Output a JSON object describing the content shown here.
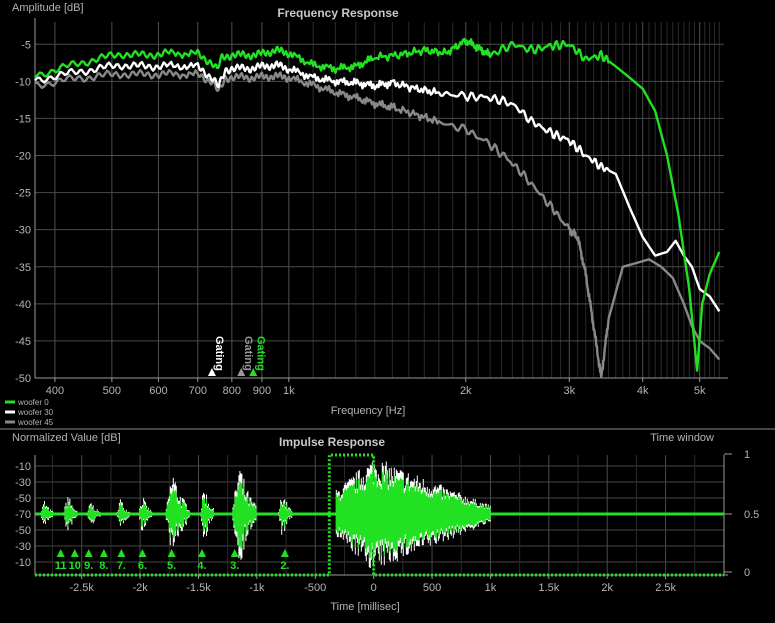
{
  "colors": {
    "green": "#22e022",
    "white": "#ffffff",
    "gray": "#888888",
    "grid": "#4a4a4a",
    "text": "#b4b4b4",
    "axis": "#9a9a9a"
  },
  "chart_data": [
    {
      "type": "line",
      "title": "Frequency Response",
      "ylabel": "Amplitude [dB]",
      "xlabel": "Frequency [Hz]",
      "xscale": "log",
      "xlim": [
        370,
        5500
      ],
      "ylim": [
        -50,
        -2
      ],
      "grid": true,
      "xticks": [
        400,
        500,
        600,
        700,
        800,
        900,
        1000,
        2000,
        3000,
        4000,
        5000
      ],
      "xtick_labels": [
        "400",
        "500",
        "600",
        "700",
        "800",
        "900",
        "1k",
        "2k",
        "3k",
        "4k",
        "5k"
      ],
      "yticks": [
        -5,
        -10,
        -15,
        -20,
        -25,
        -30,
        -35,
        -40,
        -45,
        -50
      ],
      "ytick_labels": [
        "-5",
        "-10",
        "-15",
        "-20",
        "-25",
        "-30",
        "-35",
        "-40",
        "-45",
        "-50"
      ],
      "legend_position": "bottom-left",
      "series": [
        {
          "name": "woofer 0",
          "color": "#22e022",
          "points": [
            [
              370,
              -9.2
            ],
            [
              420,
              -8
            ],
            [
              470,
              -7
            ],
            [
              520,
              -6.3
            ],
            [
              570,
              -6.5
            ],
            [
              620,
              -6.2
            ],
            [
              700,
              -6.3
            ],
            [
              740,
              -7.5
            ],
            [
              755,
              -8.5
            ],
            [
              770,
              -6.8
            ],
            [
              800,
              -6.4
            ],
            [
              850,
              -6.5
            ],
            [
              900,
              -6.3
            ],
            [
              950,
              -5.8
            ],
            [
              1000,
              -6.2
            ],
            [
              1100,
              -7.8
            ],
            [
              1200,
              -8.3
            ],
            [
              1300,
              -8
            ],
            [
              1400,
              -6.8
            ],
            [
              1550,
              -6.4
            ],
            [
              1700,
              -5.8
            ],
            [
              1850,
              -6.2
            ],
            [
              2000,
              -4.5
            ],
            [
              2100,
              -5.5
            ],
            [
              2200,
              -6.5
            ],
            [
              2400,
              -5
            ],
            [
              2600,
              -5.8
            ],
            [
              2800,
              -5.2
            ],
            [
              3000,
              -5
            ],
            [
              3200,
              -7
            ],
            [
              3400,
              -6.5
            ],
            [
              3600,
              -8
            ],
            [
              3800,
              -9.5
            ],
            [
              4000,
              -11
            ],
            [
              4200,
              -14
            ],
            [
              4400,
              -20
            ],
            [
              4600,
              -28
            ],
            [
              4800,
              -38
            ],
            [
              4950,
              -49
            ],
            [
              5050,
              -40
            ],
            [
              5200,
              -36
            ],
            [
              5400,
              -33
            ]
          ]
        },
        {
          "name": "woofer 30",
          "color": "#ffffff",
          "points": [
            [
              370,
              -9.8
            ],
            [
              420,
              -9
            ],
            [
              470,
              -8.3
            ],
            [
              520,
              -7.8
            ],
            [
              570,
              -8
            ],
            [
              620,
              -7.9
            ],
            [
              700,
              -8
            ],
            [
              740,
              -9.5
            ],
            [
              760,
              -10.8
            ],
            [
              780,
              -8.5
            ],
            [
              800,
              -8.2
            ],
            [
              850,
              -8.3
            ],
            [
              900,
              -8
            ],
            [
              950,
              -7.8
            ],
            [
              1000,
              -8.3
            ],
            [
              1100,
              -9.5
            ],
            [
              1200,
              -10
            ],
            [
              1300,
              -10.2
            ],
            [
              1400,
              -10.6
            ],
            [
              1500,
              -10.2
            ],
            [
              1650,
              -11
            ],
            [
              1800,
              -11.6
            ],
            [
              2000,
              -12
            ],
            [
              2200,
              -12.2
            ],
            [
              2400,
              -13
            ],
            [
              2600,
              -15.5
            ],
            [
              2800,
              -17
            ],
            [
              3000,
              -18
            ],
            [
              3200,
              -20
            ],
            [
              3400,
              -21.5
            ],
            [
              3600,
              -22.5
            ],
            [
              3800,
              -27
            ],
            [
              4000,
              -31
            ],
            [
              4200,
              -33.5
            ],
            [
              4400,
              -33
            ],
            [
              4550,
              -31.5
            ],
            [
              4700,
              -33.5
            ],
            [
              4850,
              -35
            ],
            [
              5000,
              -38
            ],
            [
              5200,
              -39
            ],
            [
              5400,
              -41
            ]
          ]
        },
        {
          "name": "woofer 45",
          "color": "#888888",
          "points": [
            [
              370,
              -10.5
            ],
            [
              420,
              -9.8
            ],
            [
              470,
              -9.3
            ],
            [
              520,
              -9
            ],
            [
              570,
              -9.1
            ],
            [
              620,
              -9
            ],
            [
              700,
              -9.1
            ],
            [
              740,
              -10
            ],
            [
              760,
              -11.5
            ],
            [
              780,
              -9.6
            ],
            [
              800,
              -9.4
            ],
            [
              850,
              -9.5
            ],
            [
              900,
              -9.4
            ],
            [
              950,
              -9.3
            ],
            [
              1000,
              -9.5
            ],
            [
              1100,
              -10.5
            ],
            [
              1200,
              -11.5
            ],
            [
              1300,
              -12.2
            ],
            [
              1400,
              -13
            ],
            [
              1500,
              -13.5
            ],
            [
              1650,
              -14.5
            ],
            [
              1800,
              -15.5
            ],
            [
              2000,
              -16.5
            ],
            [
              2200,
              -18.5
            ],
            [
              2400,
              -21
            ],
            [
              2600,
              -24
            ],
            [
              2800,
              -27
            ],
            [
              3000,
              -30
            ],
            [
              3100,
              -31
            ],
            [
              3200,
              -36
            ],
            [
              3300,
              -43
            ],
            [
              3400,
              -50
            ],
            [
              3500,
              -42
            ],
            [
              3700,
              -35
            ],
            [
              3900,
              -34.5
            ],
            [
              4100,
              -34
            ],
            [
              4300,
              -35
            ],
            [
              4500,
              -36.5
            ],
            [
              4700,
              -40
            ],
            [
              4850,
              -43
            ],
            [
              5000,
              -45
            ],
            [
              5200,
              -46
            ],
            [
              5400,
              -47.5
            ]
          ]
        }
      ],
      "gating_markers": [
        {
          "label": "Gating",
          "x": 740,
          "color": "#ffffff"
        },
        {
          "label": "Gating",
          "x": 830,
          "color": "#999999"
        },
        {
          "label": "Gating",
          "x": 870,
          "color": "#22e022"
        }
      ]
    },
    {
      "type": "line",
      "title": "Impulse Response",
      "ylabel": "Normalized Value [dB]",
      "xlabel": "Time [millisec]",
      "right_label": "Time window",
      "xlim": [
        -2.9,
        3.0
      ],
      "ylim": [
        -120,
        0
      ],
      "grid": true,
      "xticks": [
        -2.5,
        -2.0,
        -1.5,
        -1.0,
        -0.5,
        0,
        0.5,
        1.0,
        1.5,
        2.0,
        2.5
      ],
      "xtick_labels": [
        "-2.5k",
        "-2k",
        "-1.5k",
        "-1k",
        "-500",
        "0",
        "500",
        "1k",
        "1.5k",
        "2k",
        "2.5k"
      ],
      "yticks": [
        -10,
        -30,
        -50,
        -70,
        -50,
        -30,
        -10
      ],
      "ytick_labels": [
        "-10",
        "-30",
        "-50",
        "-70",
        "-50",
        "-30",
        "-10"
      ],
      "right_ticks": [
        1,
        0.5,
        0
      ],
      "right_tick_labels": [
        "1",
        "0.5",
        "0"
      ],
      "window": {
        "start": -0.38,
        "end": 3.0,
        "peak": 0
      },
      "bursts": [
        {
          "t": -2.82,
          "h": 0.25
        },
        {
          "t": -2.62,
          "h": 0.4
        },
        {
          "t": -2.42,
          "h": 0.25
        },
        {
          "t": -2.17,
          "h": 0.3
        },
        {
          "t": -1.98,
          "h": 0.35
        },
        {
          "t": -1.72,
          "h": 0.8
        },
        {
          "t": -1.45,
          "h": 0.55
        },
        {
          "t": -1.15,
          "h": 0.95
        },
        {
          "t": -0.78,
          "h": 0.45
        }
      ],
      "markers": [
        {
          "label": "11",
          "t": -2.68
        },
        {
          "label": "10",
          "t": -2.56
        },
        {
          "label": "9.",
          "t": -2.44
        },
        {
          "label": "8.",
          "t": -2.31
        },
        {
          "label": "7.",
          "t": -2.16
        },
        {
          "label": "6.",
          "t": -1.98
        },
        {
          "label": "5.",
          "t": -1.73
        },
        {
          "label": "4.",
          "t": -1.47
        },
        {
          "label": "3.",
          "t": -1.19
        },
        {
          "label": "2.",
          "t": -0.76
        }
      ]
    }
  ]
}
